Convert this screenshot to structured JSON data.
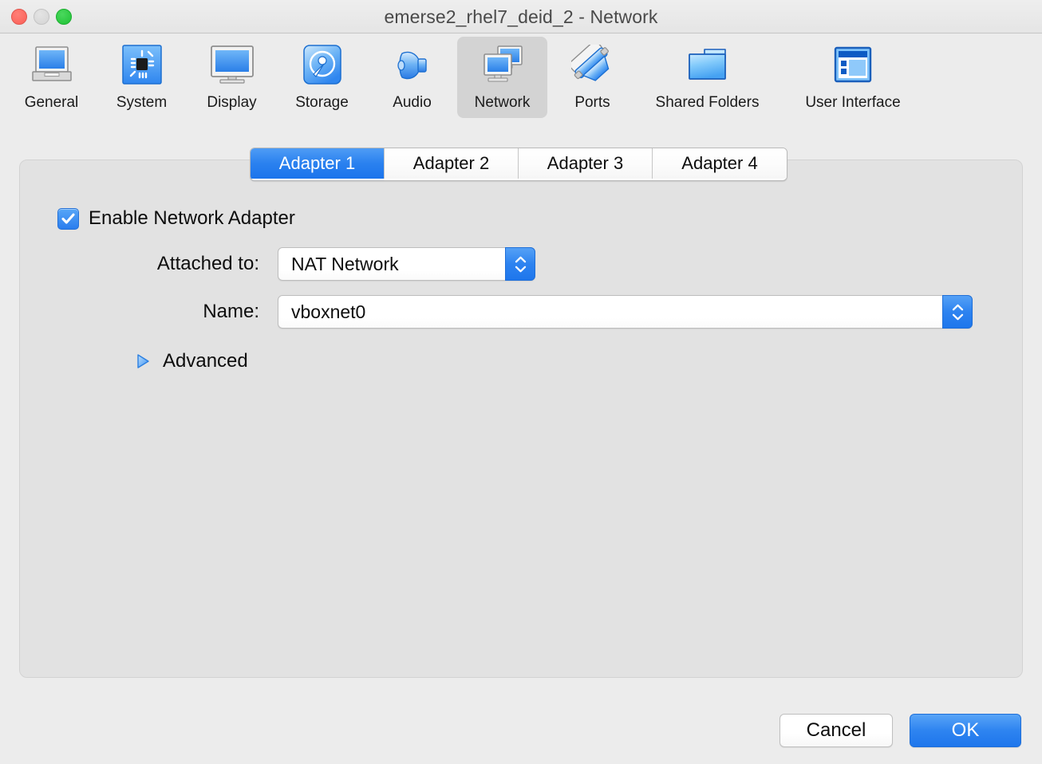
{
  "window": {
    "title": "emerse2_rhel7_deid_2 - Network",
    "traffic_lights": [
      {
        "name": "close",
        "color": "#fb5f56"
      },
      {
        "name": "minimize",
        "color": "#d4d4d4"
      },
      {
        "name": "maximize",
        "color": "#1fc235"
      }
    ]
  },
  "toolbar": {
    "selected": "Network",
    "items": [
      {
        "label": "General",
        "icon": "computer-icon"
      },
      {
        "label": "System",
        "icon": "chip-icon"
      },
      {
        "label": "Display",
        "icon": "monitor-icon"
      },
      {
        "label": "Storage",
        "icon": "disk-icon"
      },
      {
        "label": "Audio",
        "icon": "speaker-icon"
      },
      {
        "label": "Network",
        "icon": "network-icon"
      },
      {
        "label": "Ports",
        "icon": "port-connector-icon"
      },
      {
        "label": "Shared Folders",
        "icon": "folder-icon"
      },
      {
        "label": "User Interface",
        "icon": "window-layout-icon"
      }
    ]
  },
  "tabs": {
    "active_index": 0,
    "items": [
      {
        "label": "Adapter 1"
      },
      {
        "label": "Adapter 2"
      },
      {
        "label": "Adapter 3"
      },
      {
        "label": "Adapter 4"
      }
    ]
  },
  "form": {
    "enable_adapter": {
      "label": "Enable Network Adapter",
      "checked": true
    },
    "attached_to": {
      "label": "Attached to:",
      "value": "NAT Network"
    },
    "name": {
      "label": "Name:",
      "value": "vboxnet0"
    },
    "advanced": {
      "label": "Advanced",
      "expanded": false
    }
  },
  "footer": {
    "cancel_label": "Cancel",
    "ok_label": "OK"
  },
  "colors": {
    "accent_blue": "#2a81ef",
    "window_bg": "#ececec",
    "panel_bg": "#e2e2e2",
    "selected_toolbar_bg": "#d3d3d3"
  }
}
